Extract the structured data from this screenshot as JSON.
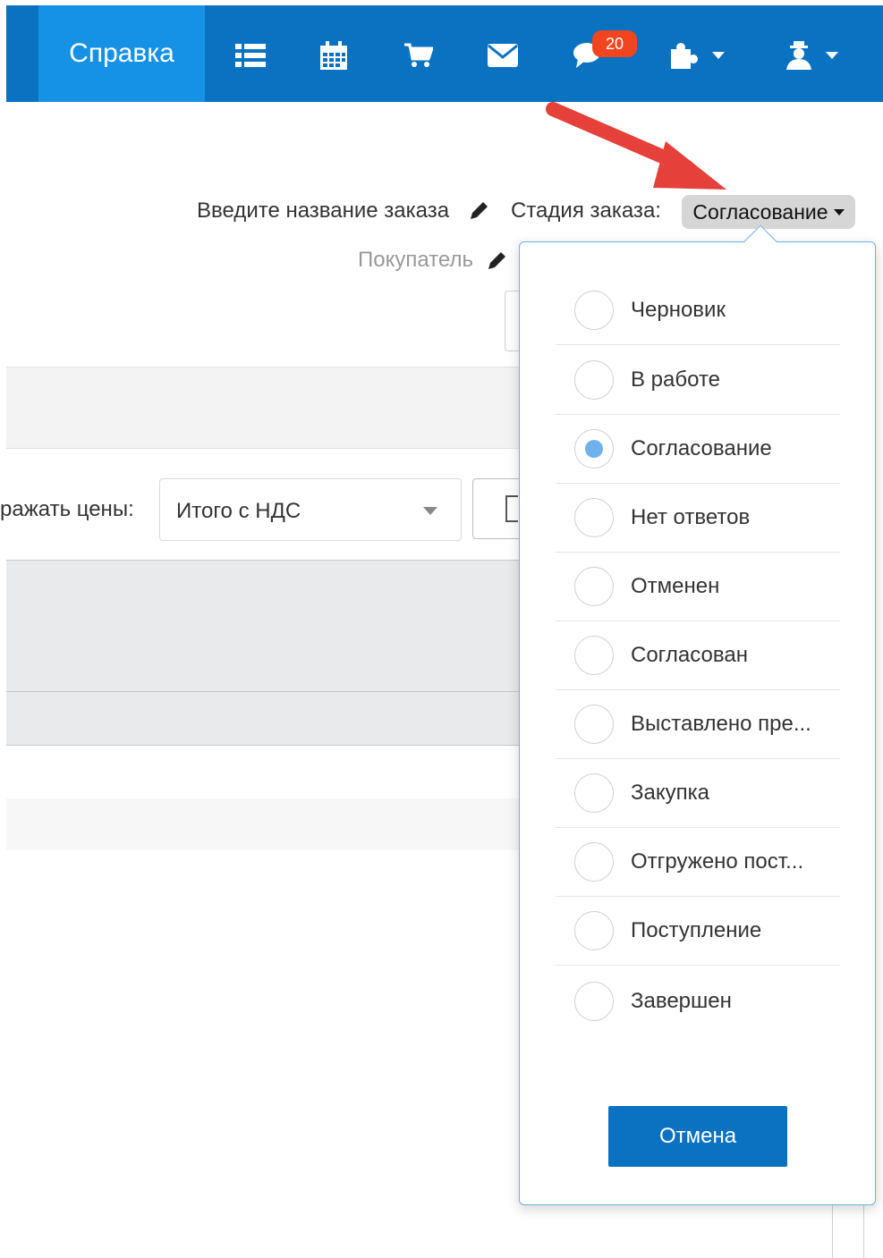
{
  "nav": {
    "help_label": "Справка",
    "messages_count": "20",
    "icons": [
      "list-icon",
      "calendar-icon",
      "cart-icon",
      "mail-icon",
      "chat-icon",
      "puzzle-icon",
      "user-icon"
    ]
  },
  "order": {
    "name_placeholder": "Введите название заказа",
    "stage_label": "Стадия заказа:",
    "stage_value": "Согласование",
    "buyer_placeholder": "Покупатель"
  },
  "prices": {
    "label": "ражать цены:",
    "selected": "Итого с НДС"
  },
  "stage_menu": {
    "options": [
      {
        "label": "Черновик",
        "checked": false
      },
      {
        "label": "В работе",
        "checked": false
      },
      {
        "label": "Согласование",
        "checked": true
      },
      {
        "label": "Нет ответов",
        "checked": false
      },
      {
        "label": "Отменен",
        "checked": false
      },
      {
        "label": "Согласован",
        "checked": false
      },
      {
        "label": "Выставлено пре...",
        "checked": false
      },
      {
        "label": "Закупка",
        "checked": false
      },
      {
        "label": "Отгружено пост...",
        "checked": false
      },
      {
        "label": "Поступление",
        "checked": false
      },
      {
        "label": "Завершен",
        "checked": false
      }
    ],
    "cancel_label": "Отмена"
  },
  "colors": {
    "nav_bg": "#0a72c0",
    "nav_active": "#1592e6",
    "badge": "#f2451f",
    "radio_checked": "#6fb1ea",
    "annotation_arrow": "#e5403a"
  }
}
